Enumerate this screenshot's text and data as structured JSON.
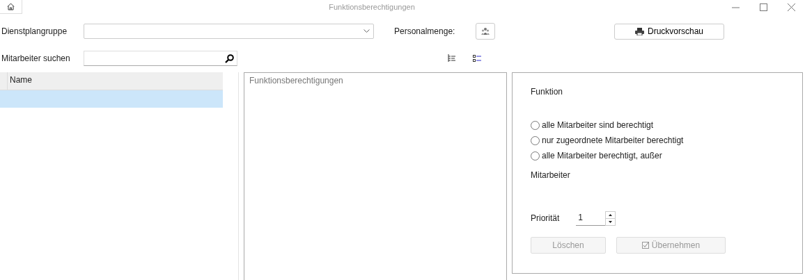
{
  "window": {
    "title": "Funktionsberechtigungen"
  },
  "filters": {
    "group_label": "Dienstplangruppe",
    "staff_label": "Personalmenge:",
    "print_button": "Druckvorschau",
    "search_label": "Mitarbeiter suchen"
  },
  "table": {
    "columns": [
      "Name"
    ],
    "rows": [
      {
        "selected": true
      }
    ]
  },
  "tree_panel": {
    "title": "Funktionsberechtigungen"
  },
  "detail": {
    "function_label": "Funktion",
    "options": [
      {
        "label": "alle Mitarbeiter sind berechtigt",
        "selected": false
      },
      {
        "label": "nur zugeordnete Mitarbeiter berechtigt",
        "selected": false
      },
      {
        "label": "alle Mitarbeiter berechtigt, außer",
        "selected": false
      }
    ],
    "employees_label": "Mitarbeiter",
    "priority_label": "Priorität",
    "priority_value": "1",
    "buttons": [
      {
        "label": "Löschen",
        "disabled": true,
        "kind": "plain"
      },
      {
        "label": "Übernehmen",
        "disabled": true,
        "kind": "check"
      }
    ]
  }
}
